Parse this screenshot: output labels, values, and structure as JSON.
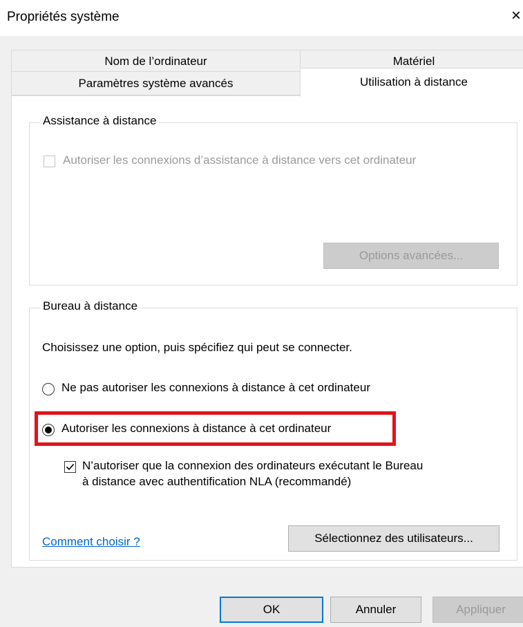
{
  "window": {
    "title": "Propriétés système",
    "close_glyph": "×",
    "close_icon": "close-icon"
  },
  "tabs": [
    {
      "label": "Nom de l’ordinateur",
      "selected": false
    },
    {
      "label": "Matériel",
      "selected": false
    },
    {
      "label": "Paramètres système avancés",
      "selected": false
    },
    {
      "label": "Utilisation à distance",
      "selected": true
    }
  ],
  "remote_assistance": {
    "legend": "Assistance à distance",
    "checkbox_label": "Autoriser les connexions d’assistance à distance vers cet ordinateur",
    "checked": false,
    "enabled": false,
    "advanced_button": "Options avancées..."
  },
  "remote_desktop": {
    "legend": "Bureau à distance",
    "instruction": "Choisissez une option, puis spécifiez qui peut se connecter.",
    "options": [
      {
        "label": "Ne pas autoriser les connexions à distance à cet ordinateur",
        "selected": false
      },
      {
        "label": "Autoriser les connexions à distance à cet ordinateur",
        "selected": true
      }
    ],
    "nla_checkbox": {
      "line1": "N’autoriser que la connexion des ordinateurs exécutant le Bureau",
      "line2": "à distance avec authentification NLA (recommandé)",
      "checked": true
    },
    "help_link": "Comment choisir ?",
    "select_users_button": "Sélectionnez des utilisateurs..."
  },
  "footer": {
    "ok": "OK",
    "cancel": "Annuler",
    "apply": "Appliquer",
    "apply_enabled": false
  },
  "annotation": {
    "highlight_color": "#e0141c"
  },
  "colors": {
    "accent": "#0078d7",
    "link": "#0066cc",
    "disabled_text": "#9a9a9a",
    "dialog_background": "#f0f0f0"
  }
}
